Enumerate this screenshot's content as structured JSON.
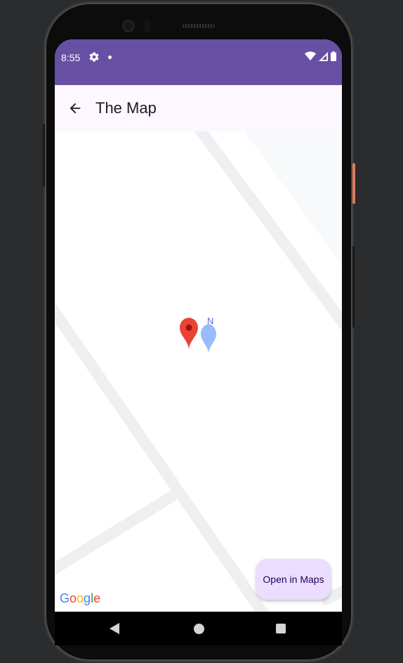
{
  "status_bar": {
    "time": "8:55",
    "icons": [
      "settings-gear-icon",
      "notification-dot-icon",
      "wifi-icon",
      "signal-icon",
      "battery-icon"
    ],
    "background": "#6750a4"
  },
  "app_bar": {
    "title": "The Map",
    "back_icon": "arrow-back-icon",
    "background": "#fdf7ff"
  },
  "map": {
    "marker_label": "N",
    "attribution": "Google"
  },
  "fab": {
    "label": "Open in Maps",
    "background": "#eaddff"
  },
  "nav_bar": {
    "icons": [
      "nav-back-icon",
      "nav-home-icon",
      "nav-recents-icon"
    ]
  }
}
